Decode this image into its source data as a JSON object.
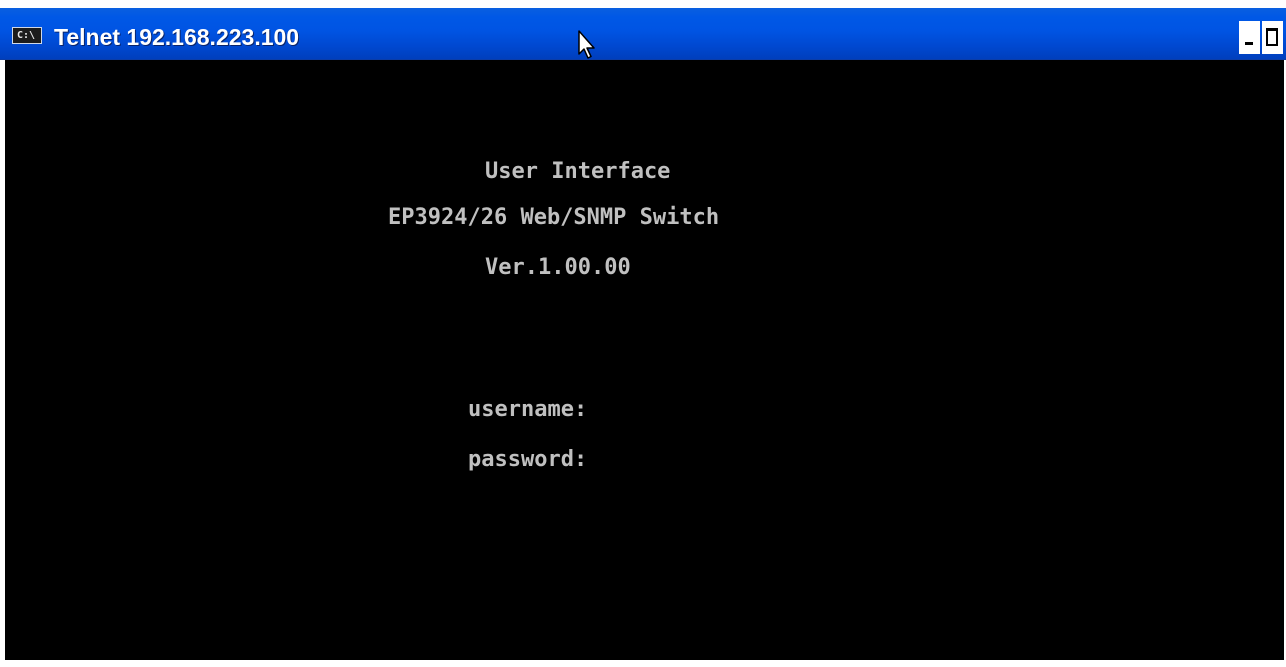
{
  "window": {
    "title": "Telnet 192.168.223.100",
    "icon_label": "C:\\",
    "icon": "cmd-console-icon",
    "controls": {
      "minimize_icon": "minimize-icon",
      "maximize_icon": "maximize-icon"
    },
    "titlebar_color": "#0054e3"
  },
  "console": {
    "background": "#000000",
    "text_color": "#c0c0c0",
    "banner": {
      "title": "User Interface",
      "model": "EP3924/26 Web/SNMP Switch",
      "version": "Ver.1.00.00"
    },
    "login": {
      "username_prompt": "username:",
      "password_prompt": "password:"
    }
  }
}
